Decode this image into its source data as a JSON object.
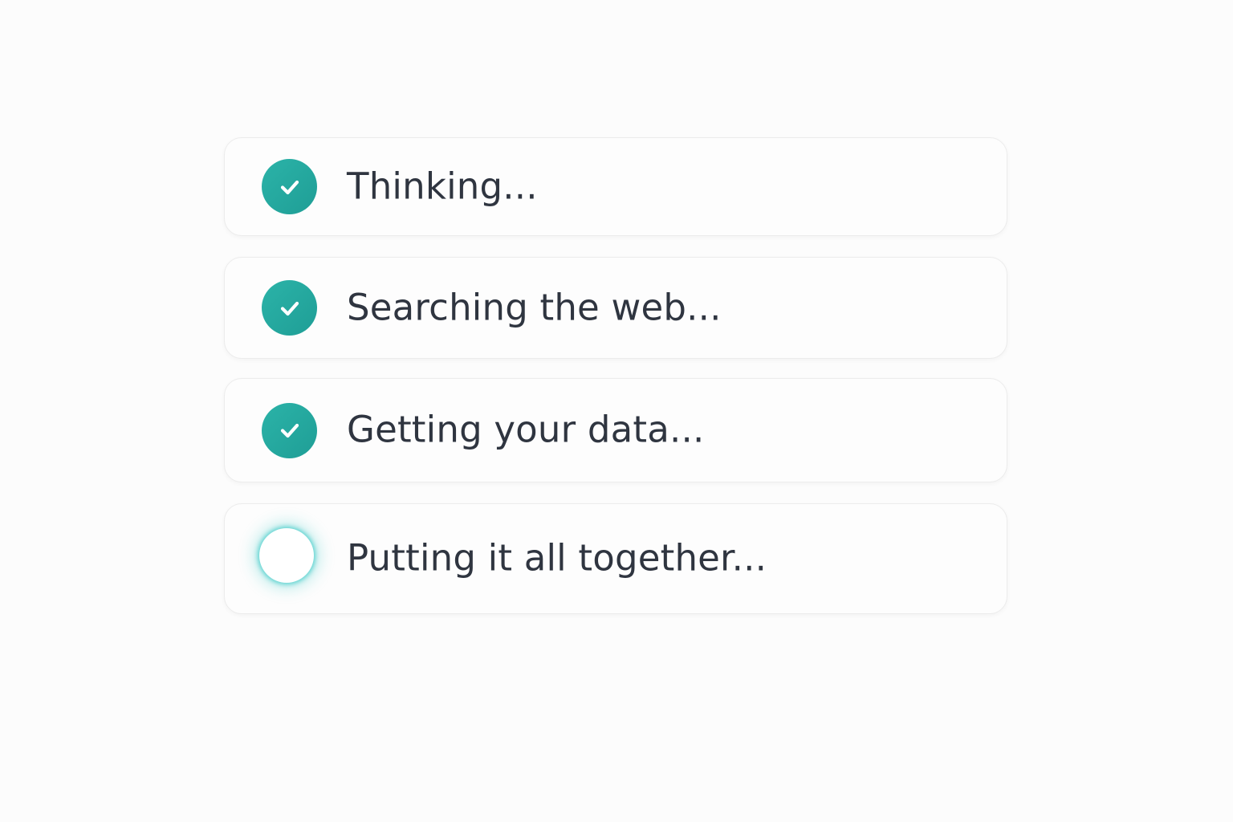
{
  "colors": {
    "accent": "#22a89e",
    "glow": "#36c8c6",
    "text": "#2f3540",
    "card_border": "#ececec",
    "background": "#fcfcfc"
  },
  "steps": [
    {
      "label": "Thinking...",
      "status": "complete",
      "icon": "check-circle-icon"
    },
    {
      "label": "Searching the web...",
      "status": "complete",
      "icon": "check-circle-icon"
    },
    {
      "label": "Getting your data...",
      "status": "complete",
      "icon": "check-circle-icon"
    },
    {
      "label": "Putting it all together...",
      "status": "in-progress",
      "icon": "pending-circle-icon"
    }
  ]
}
